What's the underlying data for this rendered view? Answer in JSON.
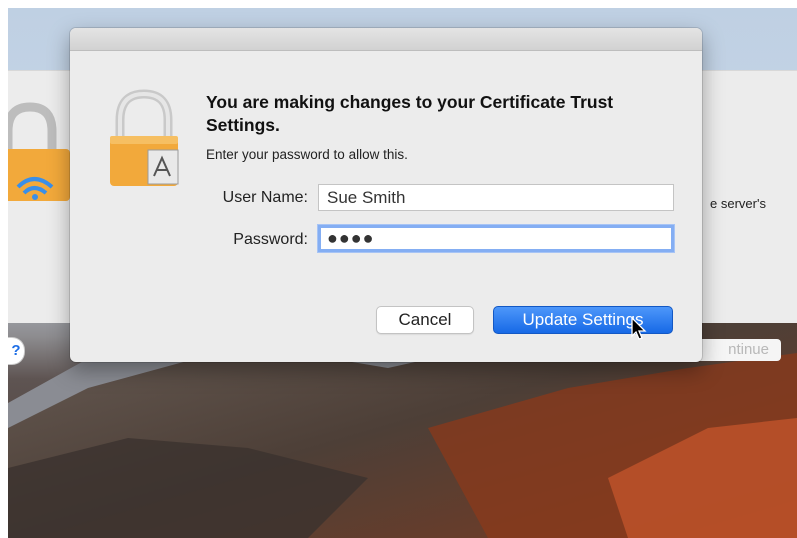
{
  "background_window": {
    "partial_text": "e server's",
    "continue_button_label": "ntinue",
    "help_button_label": "?"
  },
  "dialog": {
    "title": "You are making changes to your Certificate Trust Settings.",
    "subtitle": "Enter your password to allow this.",
    "fields": {
      "user_name_label": "User Name:",
      "user_name_value": "Sue Smith",
      "password_label": "Password:",
      "password_value": "●●●●"
    },
    "buttons": {
      "cancel_label": "Cancel",
      "update_label": "Update Settings"
    },
    "icon": "lock-certificate-icon"
  },
  "colors": {
    "accent_blue": "#1769e6",
    "focus_ring": "#84aef3",
    "lock_gold": "#f2a93b"
  }
}
